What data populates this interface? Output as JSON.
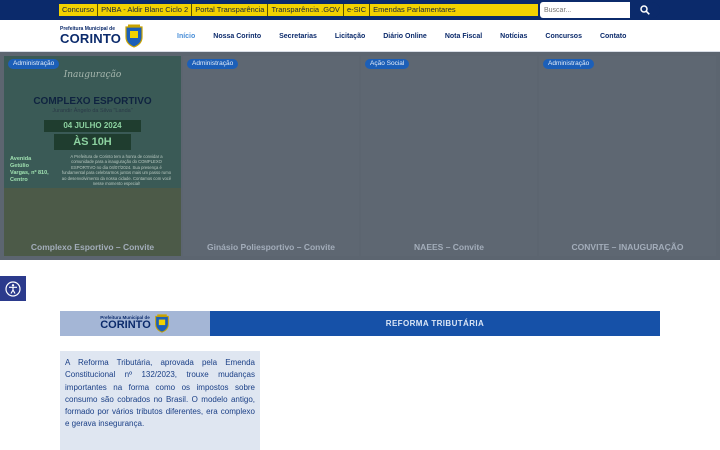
{
  "topbar": {
    "links": [
      "Concurso",
      "PNBA - Aldir Blanc Ciclo 2",
      "Portal Transparência",
      "Transparência .GOV",
      "e-SIC",
      "Emendas Parlamentares"
    ],
    "search_placeholder": "Buscar..."
  },
  "logo": {
    "line1": "Prefeitura Municipal de",
    "line2": "CORINTO"
  },
  "nav": {
    "items": [
      "Início",
      "Nossa Corinto",
      "Secretarias",
      "Licitação",
      "Diário Online",
      "Nota Fiscal",
      "Notícias",
      "Concursos",
      "Contato"
    ],
    "active": "Início"
  },
  "slides": [
    {
      "badge": "Administração",
      "caption": "Complexo Esportivo – Convite",
      "poster": {
        "script": "Inauguração",
        "title": "COMPLEXO ESPORTIVO",
        "subtitle": "Jurandir Ângelo da Silva \"Landa\"",
        "date": "04 JULHO 2024",
        "time": "ÀS 10H",
        "address": "Avenida Getúlio Vargas, nº 810, Centro",
        "note": "A Prefeitura de Corinto tem a honra de convidar a comunidade para a inauguração do COMPLEXO ESPORTIVO no dia 04/07/2024. Sua presença é fundamental para celebrarmos juntos mais um passo rumo ao desenvolvimento da nossa cidade. Contamos com você nesse momento especial!"
      }
    },
    {
      "badge": "Administração",
      "caption": "Ginásio Poliesportivo – Convite"
    },
    {
      "badge": "Ação Social",
      "caption": "NAEES – Convite"
    },
    {
      "badge": "Administração",
      "caption": "CONVITE – INAUGURAÇÃO"
    }
  ],
  "reforma": {
    "logo_line1": "Prefeitura Municipal de",
    "logo_line2": "CORINTO",
    "title": "REFORMA TRIBUTÁRIA",
    "text": "A Reforma Tributária, aprovada pela Emenda Constitucional nº 132/2023, trouxe mudanças importantes na forma como os impostos sobre consumo são cobrados no Brasil. O modelo antigo, formado por vários tributos diferentes, era complexo e gerava insegurança."
  },
  "colors": {
    "navy": "#0b2a6b",
    "yellow": "#f2d200",
    "blue": "#1651a8",
    "active": "#4a8fd8"
  },
  "icons": {
    "search": "search-icon",
    "accessibility": "accessibility-icon",
    "crest": "crest-icon"
  }
}
